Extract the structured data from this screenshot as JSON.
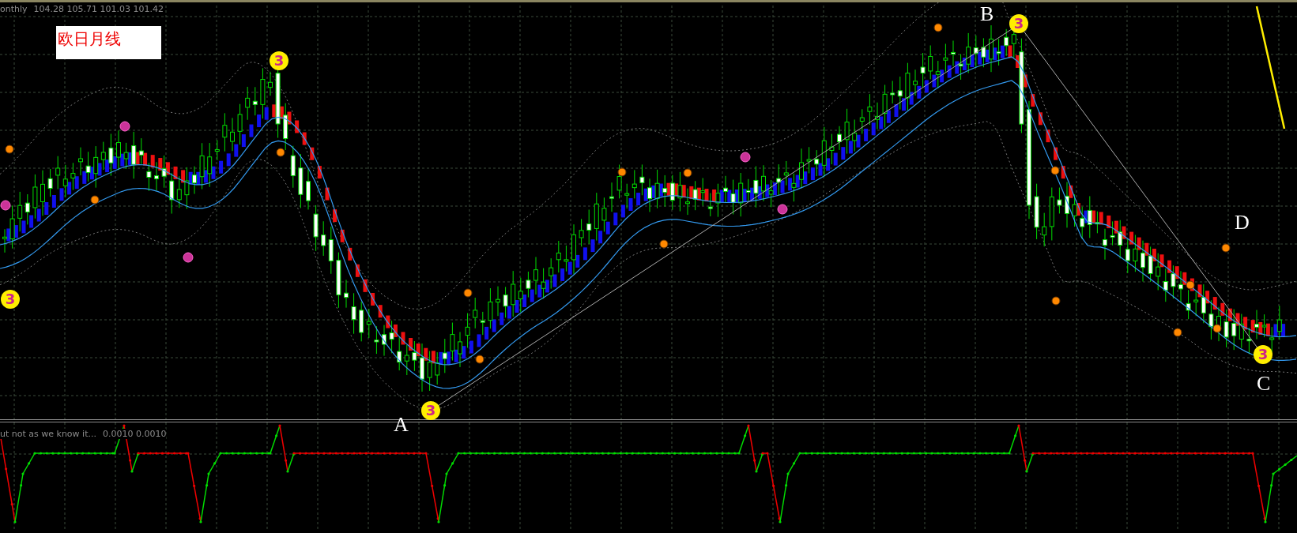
{
  "chart": {
    "symbol_info": "onthly",
    "ohlc": "104.28 105.71 101.03 101.42",
    "title_label": "欧日月线",
    "wave_labels": [
      {
        "text": "A"
      },
      {
        "text": "B"
      },
      {
        "text": "C"
      },
      {
        "text": "D"
      }
    ],
    "markers": [
      {
        "text": "3"
      },
      {
        "text": "3"
      },
      {
        "text": "3"
      },
      {
        "text": "3"
      },
      {
        "text": "3"
      }
    ]
  },
  "indicator": {
    "name": "ut not as we know it...",
    "values": "0.0010 0.0010"
  }
}
